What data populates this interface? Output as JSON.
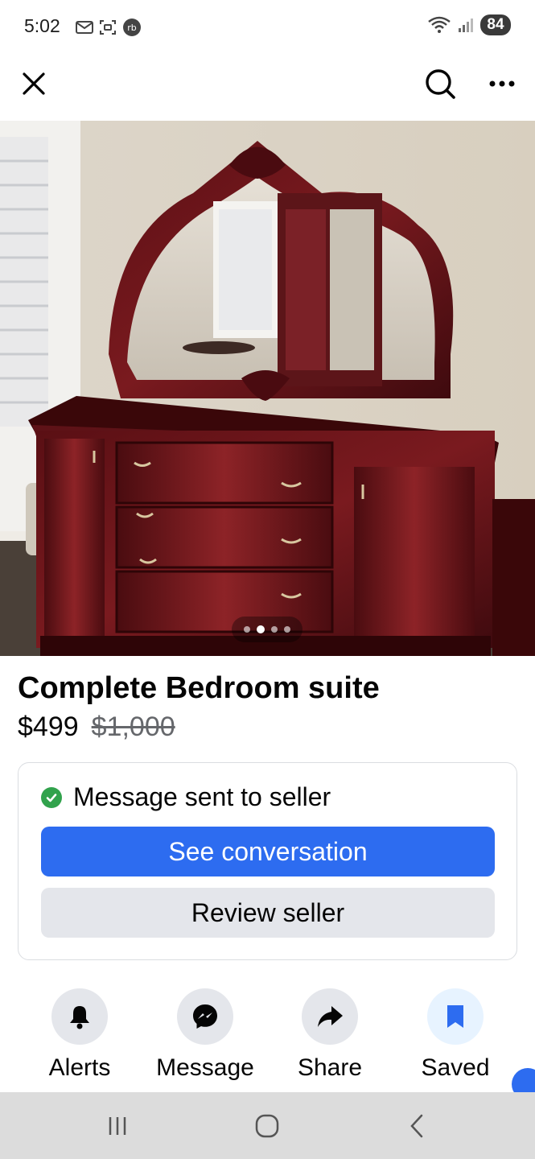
{
  "status_bar": {
    "time": "5:02",
    "battery": "84"
  },
  "top_bar": {
    "close_icon": "close-icon",
    "search_icon": "search-icon",
    "more_icon": "more-icon"
  },
  "gallery": {
    "image_count": 4,
    "active_index": 1
  },
  "listing": {
    "title": "Complete Bedroom suite",
    "price": "$499",
    "original_price": "$1,000"
  },
  "message_card": {
    "status_text": "Message sent to seller",
    "primary_button": "See conversation",
    "secondary_button": "Review seller"
  },
  "actions": [
    {
      "label": "Alerts",
      "icon": "bell-icon"
    },
    {
      "label": "Message",
      "icon": "messenger-icon"
    },
    {
      "label": "Share",
      "icon": "share-icon"
    },
    {
      "label": "Saved",
      "icon": "bookmark-icon"
    }
  ],
  "colors": {
    "primary": "#2d6cf0",
    "success": "#31a24c",
    "secondary_bg": "#e4e6eb"
  }
}
